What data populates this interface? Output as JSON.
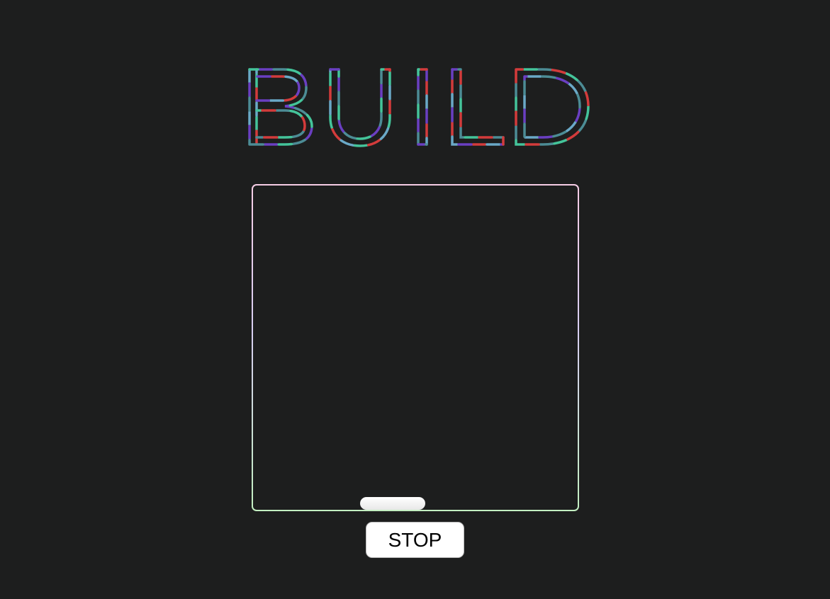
{
  "title": {
    "text": "BUILD",
    "stroke_colors": [
      "#6aa9c7",
      "#44c49a",
      "#6a3fc2",
      "#d33b3b",
      "#4c8c95"
    ]
  },
  "board": {
    "border_gradient": [
      "#f6cde6",
      "#d8cff2",
      "#c4f0c2"
    ],
    "paddle_color": "#ffffff"
  },
  "controls": {
    "stop_label": "STOP"
  },
  "background_color": "#1d1e1e"
}
